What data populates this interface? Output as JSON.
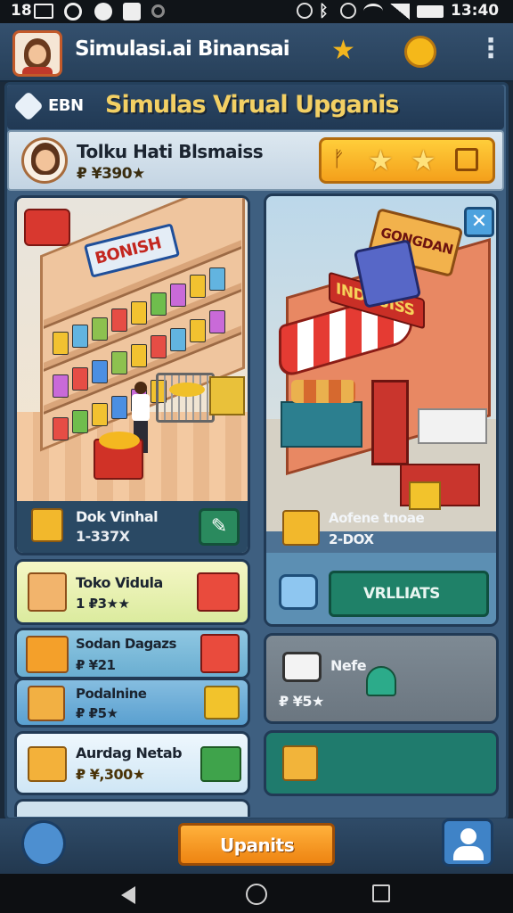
{
  "status_bar": {
    "left": "18",
    "time": "13:40"
  },
  "app": {
    "title": "Simulasi.ai Binansai"
  },
  "banner": {
    "badge": "EBN",
    "title": "Simulas Virual Upganis"
  },
  "profile": {
    "name": "Tolku Hati Blsmaiss",
    "currency": "₽ ¥390★"
  },
  "store_card": {
    "sign": "BONISH",
    "name": "Dok Vinhal",
    "sub": "1-337X"
  },
  "shop_card": {
    "awning": "INDUUISS",
    "sign": "GONGDAN",
    "name": "Aofene tnoae",
    "sub": "2-DOX",
    "button": "VRLLIATS"
  },
  "list": [
    {
      "name": "Toko Vidula",
      "value": "1 ₽3★★"
    },
    {
      "name": "Sodan Dagazs",
      "value": "₽ ¥21"
    },
    {
      "name": "Podalnine",
      "value": "₽ ₽5★"
    },
    {
      "name": "Aurdag Netab",
      "value": "₽ ¥,300★"
    }
  ],
  "vehicle_card": {
    "name": "Nefe",
    "value": "₽ ¥5★"
  },
  "bottom": {
    "button": "Upanits"
  },
  "colors": {
    "accent_orange": "#f39a22",
    "teal": "#1f8168",
    "panel": "#3e5f80"
  }
}
